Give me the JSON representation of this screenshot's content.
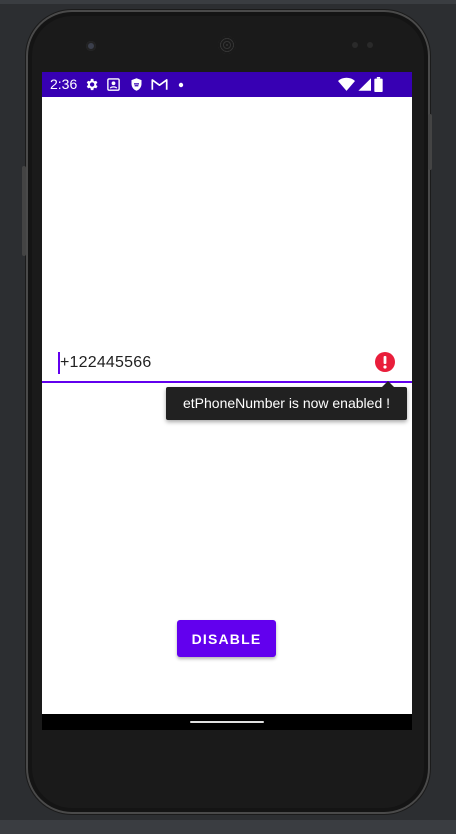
{
  "status_bar": {
    "time": "2:36",
    "background": "#3700b3",
    "left_icons": [
      "gear-icon",
      "screenshot-icon",
      "shield-icon",
      "gmail-icon",
      "dot-icon"
    ],
    "right_icons": [
      "wifi-icon",
      "signal-icon",
      "battery-icon"
    ]
  },
  "phone_field": {
    "value": "+122445566",
    "accent": "#6200ee",
    "error_color": "#e91e3b"
  },
  "error_popup": {
    "message": "etPhoneNumber is now enabled !"
  },
  "disable_button": {
    "label": "DISABLE",
    "background": "#6200ee"
  }
}
